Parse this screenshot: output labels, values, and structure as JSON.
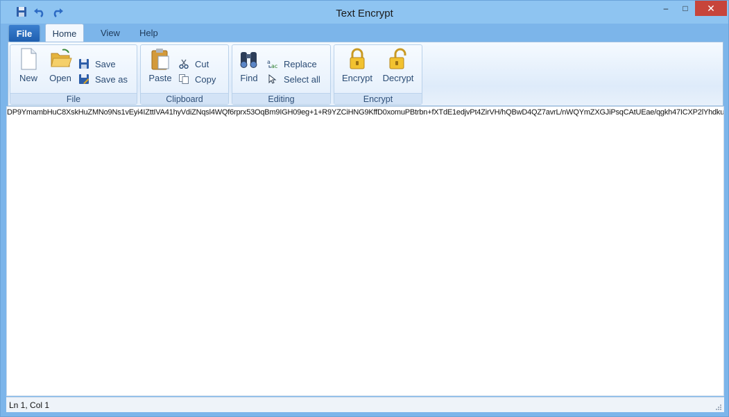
{
  "window": {
    "title": "Text Encrypt"
  },
  "qat": {
    "save_icon": "floppy-disk",
    "undo_icon": "undo-arrow",
    "redo_icon": "redo-arrow"
  },
  "window_controls": {
    "minimize": "–",
    "maximize": "□",
    "close": "✕"
  },
  "tabs": [
    {
      "label": "File"
    },
    {
      "label": "Home"
    },
    {
      "label": "View"
    },
    {
      "label": "Help"
    }
  ],
  "ribbon": {
    "file_group": {
      "label": "File",
      "new": "New",
      "open": "Open",
      "save": "Save",
      "save_as": "Save as"
    },
    "clipboard_group": {
      "label": "Clipboard",
      "paste": "Paste",
      "cut": "Cut",
      "copy": "Copy"
    },
    "editing_group": {
      "label": "Editing",
      "find": "Find",
      "replace": "Replace",
      "select_all": "Select all"
    },
    "encrypt_group": {
      "label": "Encrypt",
      "encrypt": "Encrypt",
      "decrypt": "Decrypt"
    }
  },
  "editor": {
    "content": "DP9YmambHuC8XskHuZMNo9Ns1vEyi4IZttIVA41hyVdiZNqsl4WQf6rprx53OqBm9IGH09eg+1+R9YZCiHNG9KffD0xomuPBtrbn+fXTdE1edjvPt4ZirVH/hQBwD4QZ7avrL/nWQYmZXGJiPsqCAtUEae/qgkh47ICXP2lYhdku"
  },
  "status": {
    "position": "Ln 1, Col 1"
  },
  "colors": {
    "titlebar": "#8ec4f1",
    "close": "#c7453b",
    "file_tab": "#2a6fc4",
    "ribbon_text": "#2a4b73"
  }
}
